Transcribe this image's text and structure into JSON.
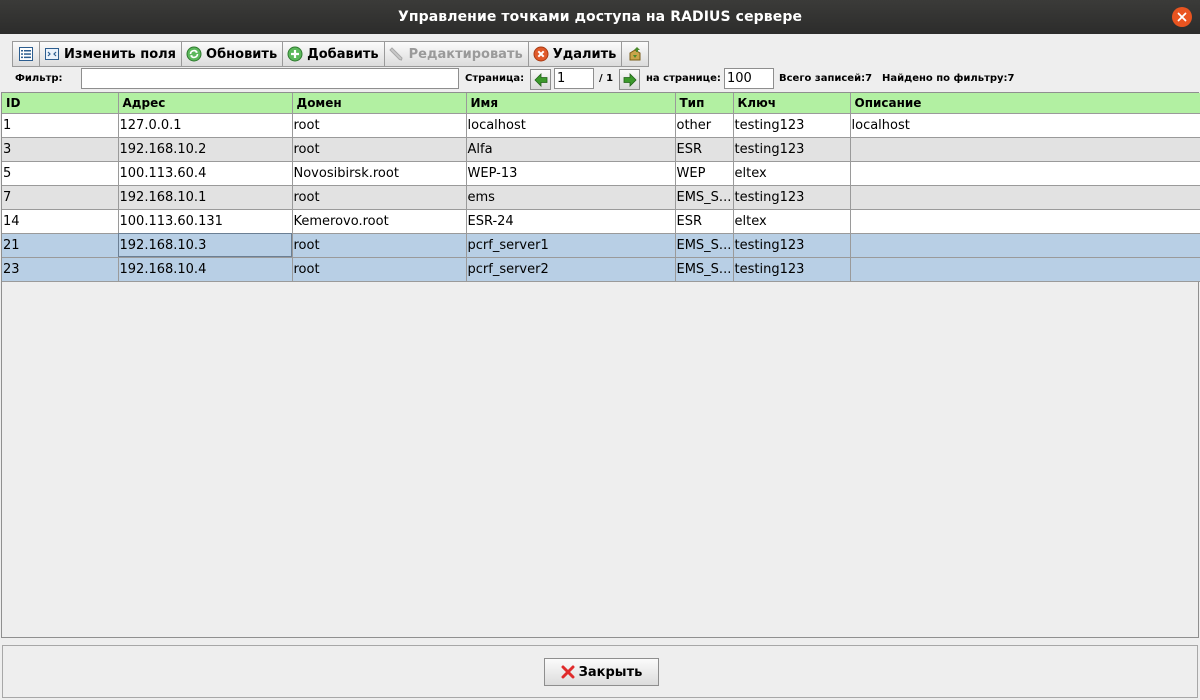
{
  "window": {
    "title": "Управление точками доступа на RADIUS сервере"
  },
  "toolbar": {
    "columns_icon": "columns-list-icon",
    "edit_fields": {
      "label": "Изменить поля",
      "icon": "fields-icon"
    },
    "refresh": {
      "label": "Обновить",
      "icon": "refresh-icon"
    },
    "add": {
      "label": "Добавить",
      "icon": "add-icon"
    },
    "edit": {
      "label": "Редактировать",
      "icon": "pencil-icon",
      "enabled": false
    },
    "delete": {
      "label": "Удалить",
      "icon": "delete-icon"
    },
    "export_icon": "export-icon"
  },
  "filter": {
    "label": "Фильтр:",
    "value": "",
    "page_label": "Страница:",
    "page_value": "1",
    "page_total": "/ 1",
    "per_page_label": "на странице:",
    "per_page_value": "100",
    "total_records": "Всего записей:7",
    "found_by_filter": "Найдено по фильтру:7"
  },
  "table": {
    "columns": [
      "ID",
      "Адрес",
      "Домен",
      "Имя",
      "Тип",
      "Ключ",
      "Описание"
    ],
    "rows": [
      [
        "1",
        "127.0.0.1",
        "root",
        "localhost",
        "other",
        "testing123",
        "localhost"
      ],
      [
        "3",
        "192.168.10.2",
        "root",
        "Alfa",
        "ESR",
        "testing123",
        ""
      ],
      [
        "5",
        "100.113.60.4",
        "Novosibirsk.root",
        "WEP-13",
        "WEP",
        "eltex",
        ""
      ],
      [
        "7",
        "192.168.10.1",
        "root",
        "ems",
        "EMS_S...",
        "testing123",
        ""
      ],
      [
        "14",
        "100.113.60.131",
        "Kemerovo.root",
        "ESR-24",
        "ESR",
        "eltex",
        ""
      ],
      [
        "21",
        "192.168.10.3",
        "root",
        "pcrf_server1",
        "EMS_S...",
        "testing123",
        ""
      ],
      [
        "23",
        "192.168.10.4",
        "root",
        "pcrf_server2",
        "EMS_S...",
        "testing123",
        ""
      ]
    ],
    "selected_row_ids": [
      "21",
      "23"
    ]
  },
  "footer": {
    "close_label": "Закрыть",
    "close_icon": "close-x-icon"
  },
  "colors": {
    "header_green": "#b2f0a2",
    "selection": "#b8cfe5",
    "title_bar": "#2c2c2b",
    "close_accent": "#e95420"
  }
}
